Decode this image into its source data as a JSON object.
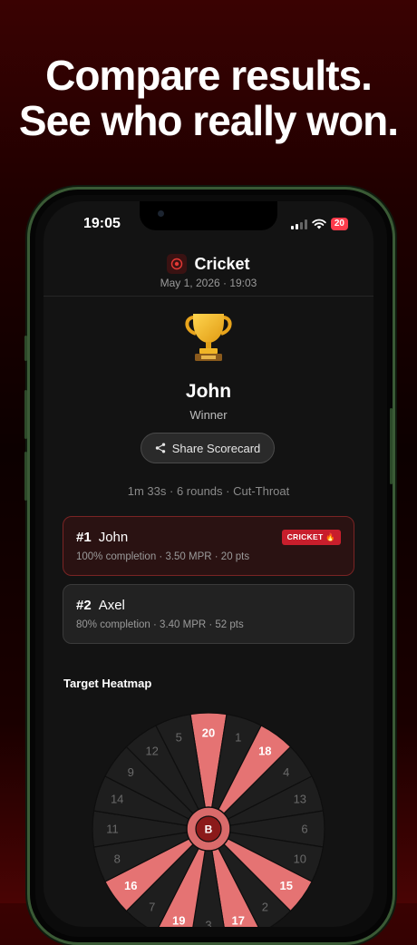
{
  "headline": {
    "line1": "Compare results.",
    "line2": "See who really won."
  },
  "status": {
    "time": "19:05",
    "battery": "20"
  },
  "header": {
    "title": "Cricket",
    "date": "May 1, 2026 · 19:03",
    "icon": "target-icon"
  },
  "winner": {
    "name": "John",
    "label": "Winner",
    "icon": "trophy-icon"
  },
  "share": {
    "label": "Share Scorecard",
    "icon": "share-icon"
  },
  "meta": "1m 33s · 6 rounds · Cut-Throat",
  "players": [
    {
      "rank": "#1",
      "name": "John",
      "stats": "100% completion · 3.50 MPR · 20 pts",
      "badge": "CRICKET 🔥"
    },
    {
      "rank": "#2",
      "name": "Axel",
      "stats": "80% completion · 3.40 MPR · 52 pts"
    }
  ],
  "heatmap": {
    "title": "Target Heatmap",
    "bull_label": "B",
    "numbers": [
      "20",
      "1",
      "18",
      "4",
      "13",
      "6",
      "10",
      "15",
      "2",
      "17",
      "3",
      "19",
      "7",
      "16",
      "8",
      "11",
      "14",
      "9",
      "12",
      "5"
    ],
    "highlighted": [
      "20",
      "18",
      "15",
      "16",
      "19",
      "17"
    ],
    "colors": {
      "highlight": "#e57373",
      "dark": "#1e1e1e",
      "bull": "#8b1a1a"
    }
  }
}
